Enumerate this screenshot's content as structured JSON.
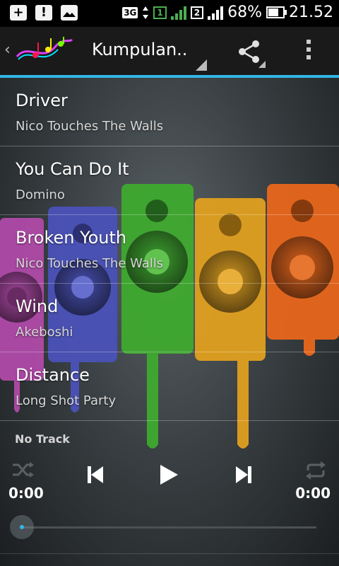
{
  "status_bar": {
    "network_type": "3G",
    "sim1": "1",
    "sim2": "2",
    "battery": "68%",
    "time": "21.52",
    "icons": [
      "add-notification-icon",
      "alert-notification-icon",
      "image-notification-icon"
    ]
  },
  "action_bar": {
    "title": "Kumpulan..",
    "accent_color": "#33b5e5"
  },
  "songs": [
    {
      "title": "Driver",
      "artist": "Nico Touches The Walls"
    },
    {
      "title": "You Can Do It",
      "artist": "Domino"
    },
    {
      "title": "Broken Youth",
      "artist": "Nico Touches The Walls"
    },
    {
      "title": "Wind",
      "artist": "Akeboshi"
    },
    {
      "title": "Distance",
      "artist": "Long Shot Party"
    }
  ],
  "player": {
    "now_playing": "No Track",
    "elapsed": "0:00",
    "duration": "0:00",
    "progress": 0
  }
}
